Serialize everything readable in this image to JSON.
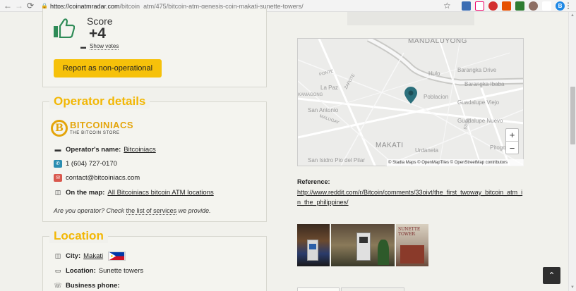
{
  "browser": {
    "url_host": "https://coinatmradar.com",
    "url_path": "/bitcoin_atm/475/bitcoin-atm-genesis-coin-makati-sunette-towers/"
  },
  "score": {
    "label": "Score",
    "value": "+4",
    "show_votes": "Show votes",
    "report_button": "Report as non-operational"
  },
  "operator": {
    "section_title": "Operator details",
    "logo_main": "BITCOINIACS",
    "logo_sub": "THE BITCOIN STORE",
    "name_label": "Operator's name:",
    "name_value": "Bitcoiniacs",
    "phone": "1 (604) 727-0170",
    "email": "contact@bitcoiniacs.com",
    "map_label": "On the map:",
    "map_link": "All Bitcoiniacs bitcoin ATM locations",
    "operator_prefix": "Are you operator? Check ",
    "operator_link": "the list of services",
    "operator_suffix": " we provide."
  },
  "location": {
    "section_title": "Location",
    "city_label": "City:",
    "city_value": "Makati",
    "location_label": "Location:",
    "location_value": "Sunette towers",
    "business_phone_label": "Business phone:"
  },
  "map": {
    "labels": {
      "mandaluyong": "MANDALUYONG",
      "makati": "MAKATI",
      "hulo": "Hulo",
      "barangka_drive": "Barangka Drive",
      "barangka_ibaba": "Barangka Ibaba",
      "la_paz": "La Paz",
      "kamagong": "KAMAGONG",
      "san_antonio": "San Antonio",
      "poblacion": "Poblacion",
      "guadalupe_nuevo": "Guadalupe Nuevo",
      "guadalupe_viejo": "Guadalupe Viejo",
      "urdaneta": "Urdaneta",
      "san_isidro": "San Isidro Pio del Pilar",
      "pitogo": "Pitogo",
      "malugay": "MALUGAY",
      "pont": "PONTE",
      "zapote": "ZAPOTE",
      "edsa": "EDSA"
    },
    "zoom_in": "+",
    "zoom_out": "−",
    "attribution": "© Stadia Maps  © OpenMapTiles  © OpenStreetMap contributors"
  },
  "reference": {
    "label": "Reference:",
    "link": "http://www.reddit.com/r/Bitcoin/comments/33oivt/the_first_twoway_bitcoin_atm_in_the_philippines/"
  },
  "photos": {
    "third_caption": "SUNETTE TOWER"
  },
  "colors": {
    "accent": "#f2b705",
    "button": "#f6c10a",
    "background": "#f1f1ec",
    "map_pin": "#2b6f7b"
  }
}
